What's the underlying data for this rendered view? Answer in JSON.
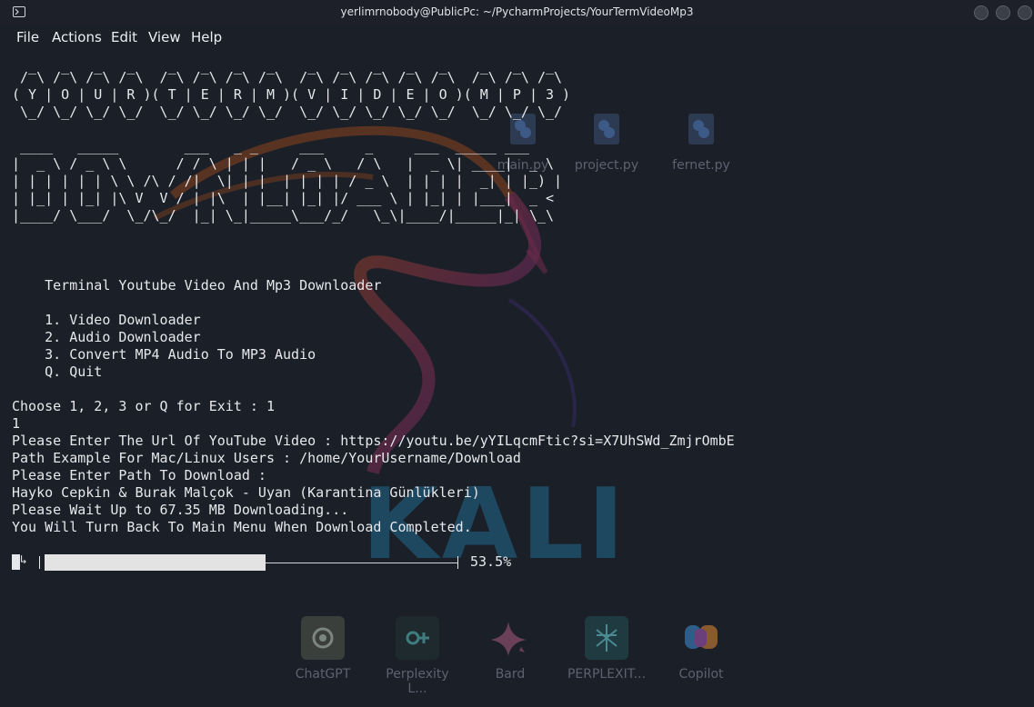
{
  "window": {
    "title": "yerlimrnobody@PublicPc: ~/PycharmProjects/YourTermVideoMp3"
  },
  "menu": [
    "File",
    "Actions",
    "Edit",
    "View",
    "Help"
  ],
  "desktop": {
    "file_icons": [
      {
        "label": "main.py",
        "icon": "python-file-icon"
      },
      {
        "label": "project.py",
        "icon": "python-file-icon"
      },
      {
        "label": "fernet.py",
        "icon": "python-file-icon"
      }
    ],
    "dock": [
      {
        "label": "ChatGPT",
        "icon": "chatgpt-icon"
      },
      {
        "label": "Perplexity L...",
        "icon": "perplexity-icon"
      },
      {
        "label": "Bard",
        "icon": "bard-icon"
      },
      {
        "label": "PERPLEXIT...",
        "icon": "perplexity-icon"
      },
      {
        "label": "Copilot",
        "icon": "copilot-icon"
      }
    ],
    "wallpaper_text": "KALI"
  },
  "terminal": {
    "ascii_banner_1": [
      "  _   _   _   _    _   _   _   _    _   _   _   _   _    _   _   _",
      " / \\ / \\ / \\ / \\  / \\ / \\ / \\ / \\  / \\ / \\ / \\ / \\ / \\  / \\ / \\ / \\",
      "( Y | O | U | R )( T | E | R | M )( V | I | D | E | O )( M | P | 3 )",
      " \\_/ \\_/ \\_/ \\_/  \\_/ \\_/ \\_/ \\_/  \\_/ \\_/ \\_/ \\_/ \\_/  \\_/ \\_/ \\_/"
    ],
    "ascii_banner_2": [
      " ____   _____        ___   _ _     ___     _     ___  _____ ___",
      "|  _ \\ / _ \\ \\      / / \\ | | |   / _ \\   / \\   |  _ \\| ____|  _ \\",
      "| | | | | | \\ \\ /\\ / /|  \\| | |  | | | | / _ \\  | | | |  _| | |_) |",
      "| |_| | |_| |\\ V  V / | |\\  | |__| |_| |/ ___ \\ | |_| | |___|  _ <",
      "|____/ \\___/  \\_/\\_/  |_| \\_|_____\\___/_/   \\_\\|____/|_____|_| \\_\\"
    ],
    "heading": "    Terminal Youtube Video And Mp3 Downloader",
    "options": [
      "    1. Video Downloader",
      "    2. Audio Downloader",
      "    3. Convert MP4 Audio To MP3 Audio",
      "    Q. Quit"
    ],
    "session": [
      "Choose 1, 2, 3 or Q for Exit : 1",
      "1",
      "Please Enter The Url Of YouTube Video : https://youtu.be/yYILqcmFtic?si=X7UhSWd_ZmjrOmbE",
      "Path Example For Mac/Linux Users : /home/YourUsername/Download",
      "Please Enter Path To Download :",
      "Hayko Cepkin & Burak Malçok - Uyan (Karantina Günlükleri)",
      "Please Wait Up to 67.35 MB Downloading...",
      "You Will Turn Back To Main Menu When Download Completed."
    ],
    "progress": {
      "fraction": 0.535,
      "label": "53.5%"
    }
  },
  "colors": {
    "background": "#1b1f27",
    "text": "#e6e8ec",
    "bar_fill": "#e3e3e3",
    "kali_blue": "#1f4f6b"
  }
}
